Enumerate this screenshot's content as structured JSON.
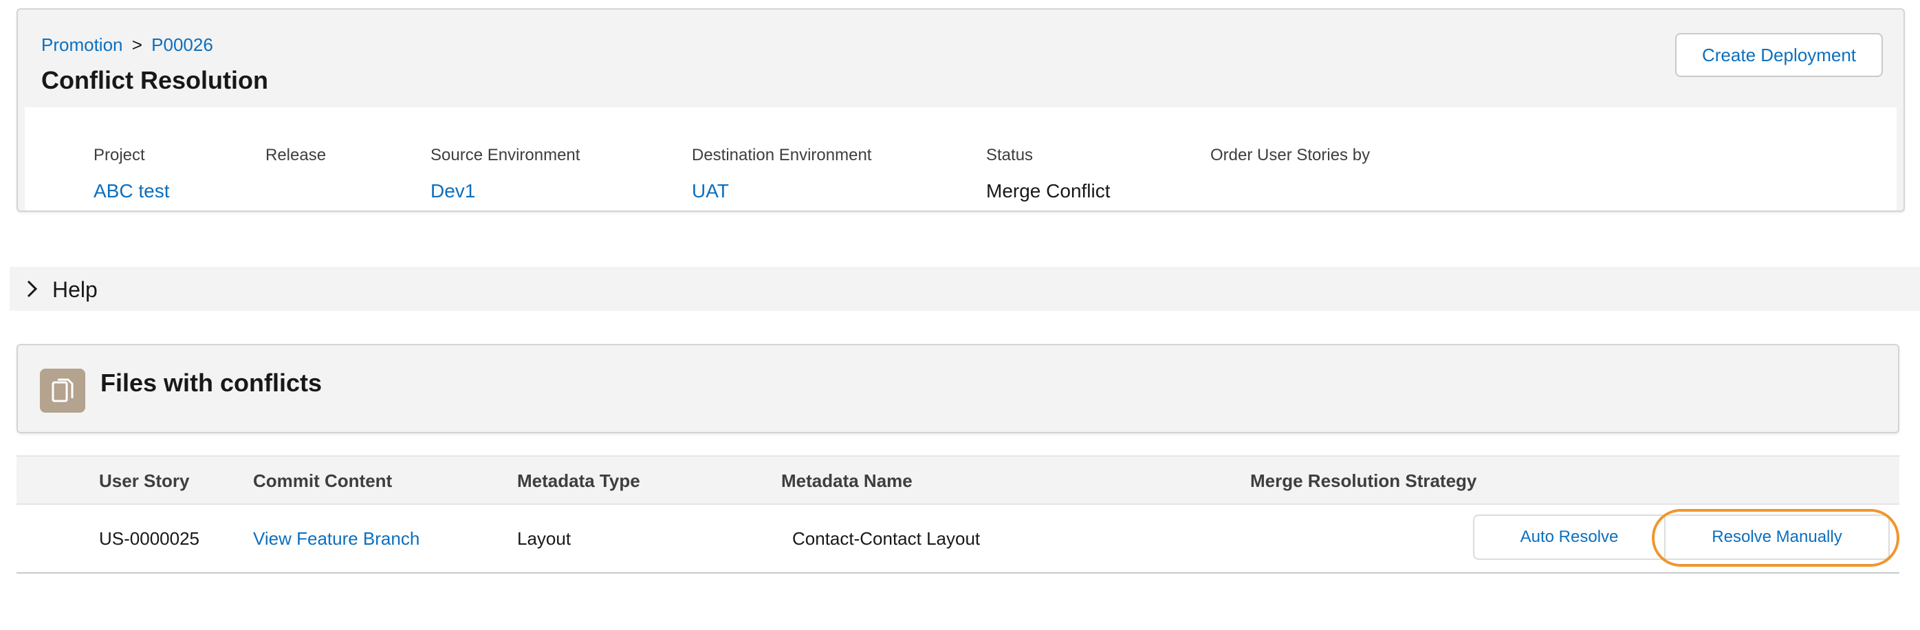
{
  "breadcrumb": {
    "parent": "Promotion",
    "separator": ">",
    "current": "P00026"
  },
  "page": {
    "title": "Conflict Resolution",
    "create_deployment_label": "Create Deployment"
  },
  "details": [
    {
      "label": "Project",
      "value": "ABC test",
      "link": true
    },
    {
      "label": "Release",
      "value": "",
      "link": false
    },
    {
      "label": "Source Environment",
      "value": "Dev1",
      "link": true
    },
    {
      "label": "Destination Environment",
      "value": "UAT",
      "link": true
    },
    {
      "label": "Status",
      "value": "Merge Conflict",
      "link": false
    },
    {
      "label": "Order User Stories by",
      "value": "",
      "link": false
    }
  ],
  "help": {
    "label": "Help",
    "icon": "chevron-right-icon"
  },
  "files": {
    "title": "Files with conflicts",
    "icon": "document-icon",
    "icon_color": "#b3a38f",
    "columns": [
      "User Story",
      "Commit Content",
      "Metadata Type",
      "Metadata Name",
      "Merge Resolution Strategy"
    ],
    "rows": [
      {
        "user_story": "US-0000025",
        "commit_content": "View Feature Branch",
        "metadata_type": "Layout",
        "metadata_name": "Contact-Contact Layout",
        "auto_resolve_label": "Auto Resolve",
        "resolve_manually_label": "Resolve Manually"
      }
    ]
  },
  "colors": {
    "link": "#0b6fbf",
    "highlight": "#f0962e",
    "panel_bg": "#f3f3f3"
  }
}
